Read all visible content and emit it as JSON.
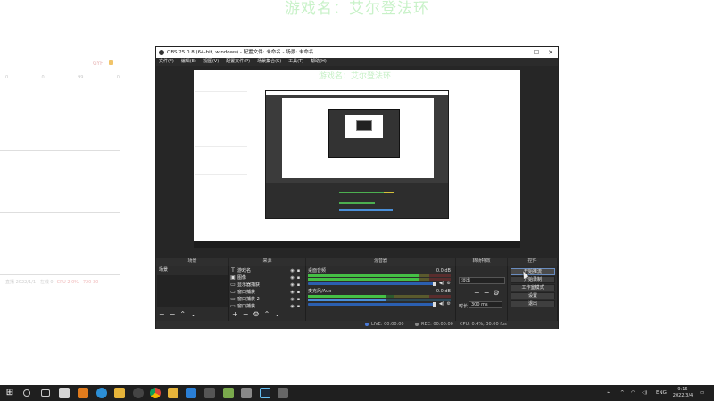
{
  "banner": {
    "text": "游戏名：艾尔登法环"
  },
  "left_panel": {
    "badge": "GYF",
    "stats": [
      "0",
      "0",
      "99",
      "0"
    ],
    "footer_left": "直播 2022/1/1 · 在线 0",
    "footer_right": "CPU 2.0% · 720 30"
  },
  "obs": {
    "title": "OBS 25.0.8 (64-bit, windows) - 配置文件: 未命名 - 场景: 未命名",
    "window_buttons": [
      "—",
      "☐",
      "✕"
    ],
    "menu": [
      "文件(F)",
      "编辑(E)",
      "视图(V)",
      "配置文件(P)",
      "场景集合(S)",
      "工具(T)",
      "帮助(H)"
    ],
    "canvas_ghost_title": "游戏名：艾尔登法环",
    "docks": {
      "scenes": "场景",
      "sources": "来源",
      "mixer": "混音器",
      "transitions": "转场特效",
      "controls": "控件"
    },
    "scene_items": [
      "场景"
    ],
    "sources": [
      {
        "icon": "text-icon",
        "glyph": "T",
        "name": "游戏名"
      },
      {
        "icon": "image-icon",
        "glyph": "▣",
        "name": "图像"
      },
      {
        "icon": "display-capture-icon",
        "glyph": "▭",
        "name": "显示器捕获"
      },
      {
        "icon": "window-capture-icon",
        "glyph": "▭",
        "name": "窗口捕获"
      },
      {
        "icon": "window-capture-icon",
        "glyph": "▭",
        "name": "窗口捕获 2"
      },
      {
        "icon": "window-capture-icon",
        "glyph": "▭",
        "name": "窗口捕获"
      }
    ],
    "mixer": [
      {
        "name": "桌面音频",
        "db": "0.0 dB",
        "level": 0.78
      },
      {
        "name": "麦克风/Aux",
        "db": "0.0 dB",
        "level": 0.55
      }
    ],
    "transitions": {
      "selected": "淡出",
      "duration_label": "时长",
      "duration_value": "300 ms"
    },
    "controls": [
      "开始推流",
      "开始录制",
      "工作室模式",
      "设置",
      "退出"
    ],
    "status": {
      "live_label": "LIVE: 00:00:00",
      "rec_label": "REC: 00:00:00",
      "cpu": "CPU: 0.4%, 30.00 fps"
    }
  },
  "taskbar": {
    "lang": "ENG",
    "time": "9:16",
    "date": "2022/3/4"
  },
  "colors": {
    "obs_bg": "#3b3b3b",
    "dock_bg": "#2c2c2c",
    "meter_green": "#45c045",
    "meter_blue": "#4a8fd8",
    "banner_green": "#c9f2c9"
  }
}
